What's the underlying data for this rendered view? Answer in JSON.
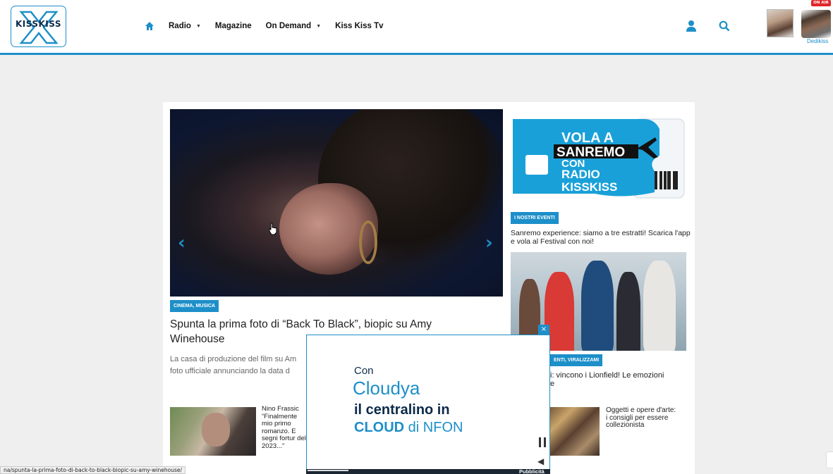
{
  "header": {
    "logo_text": "KISSKISS",
    "nav": [
      {
        "label": "Radio",
        "dropdown": true
      },
      {
        "label": "Magazine",
        "dropdown": false
      },
      {
        "label": "On Demand",
        "dropdown": true
      },
      {
        "label": "Kiss Kiss Tv",
        "dropdown": false
      }
    ],
    "onair_label": "ON AIR",
    "dj_label": "Dedikiss"
  },
  "hero": {
    "tag": "CINEMA, MUSICA",
    "title": "Spunta la prima foto di “Back To Black”, biopic su Amy Winehouse",
    "excerpt_line1": "La casa di produzione del film su Am",
    "excerpt_line2": "foto ufficiale annunciando la data d"
  },
  "side": {
    "banner": {
      "line1": "VOLA A",
      "line2": "SANREMO",
      "line3": "CON",
      "line4": "RADIO",
      "line5": "KISSKISS"
    },
    "event_tag": "I NOSTRI EVENTI",
    "event_text": "Sanremo experience: siamo a tre estratti! Scarica l'app e vola al Festival con noi!",
    "viral_tag": "ENTI, VIRALIZZAMI",
    "viral_text_line1": "i: vincono i Lionfield! Le emozioni",
    "viral_text_line2": "e"
  },
  "small_articles": [
    {
      "text": "Nino Frassic “Finalmente mio primo romanzo. E segni fortur del 2023...”"
    },
    {
      "text": "Oggetti e opere d'arte: i consigli per essere collezionista"
    }
  ],
  "ad": {
    "line_con": "Con",
    "line_cloudya": "Cloudya",
    "line_3": "il centralino in",
    "line_4_bold": "CLOUD",
    "line_4_rest": " di NFON",
    "label": "Pubblicità",
    "close": "×"
  },
  "status_url": "na/spunta-la-prima-foto-di-back-to-black-biopic-su-amy-winehouse/",
  "colors": {
    "accent": "#1d8fc9",
    "dark": "#0b2a4a",
    "onair": "#e0262a"
  }
}
